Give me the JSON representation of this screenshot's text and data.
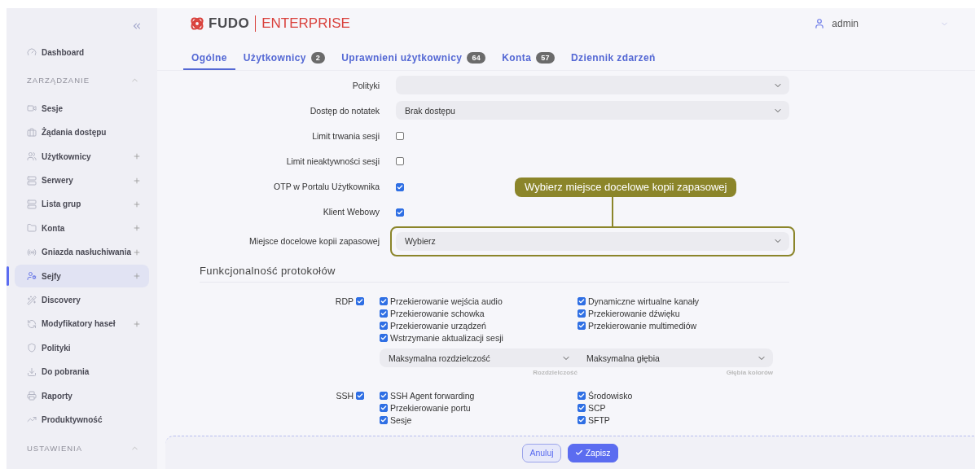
{
  "sidebar": {
    "top_item": {
      "label": "Dashboard",
      "selected": false
    },
    "sections": [
      {
        "title": "ZARZĄDZANIE",
        "expanded": true,
        "items": [
          {
            "label": "Sesje",
            "add": false,
            "selected": false
          },
          {
            "label": "Żądania dostępu",
            "add": false,
            "selected": false
          },
          {
            "label": "Użytkownicy",
            "add": true,
            "selected": false
          },
          {
            "label": "Serwery",
            "add": true,
            "selected": false
          },
          {
            "label": "Lista grup",
            "add": true,
            "selected": false
          },
          {
            "label": "Konta",
            "add": true,
            "selected": false
          },
          {
            "label": "Gniazda nasłuchiwania",
            "add": true,
            "selected": false
          },
          {
            "label": "Sejfy",
            "add": true,
            "selected": true
          },
          {
            "label": "Discovery",
            "add": false,
            "selected": false
          },
          {
            "label": "Modyfikatory haseł",
            "add": true,
            "selected": false
          },
          {
            "label": "Polityki",
            "add": false,
            "selected": false
          },
          {
            "label": "Do pobrania",
            "add": false,
            "selected": false
          },
          {
            "label": "Raporty",
            "add": false,
            "selected": false
          },
          {
            "label": "Produktywność",
            "add": false,
            "selected": false
          }
        ]
      },
      {
        "title": "USTAWIENIA",
        "expanded": true
      }
    ]
  },
  "header": {
    "logo_name": "FUDO",
    "logo_edition": "ENTERPRISE",
    "user": "admin"
  },
  "tabs": [
    {
      "label": "Ogólne",
      "selected": true
    },
    {
      "label": "Użytkownicy",
      "count": "2",
      "selected": false
    },
    {
      "label": "Uprawnieni użytkownicy",
      "count": "64",
      "selected": false
    },
    {
      "label": "Konta",
      "count": "57",
      "selected": false
    },
    {
      "label": "Dziennik zdarzeń",
      "selected": false
    }
  ],
  "form": [
    {
      "kind": "select",
      "label": "Polityki"
    },
    {
      "kind": "select",
      "label": "Dostęp do notatek",
      "value": "Brak dostępu"
    },
    {
      "kind": "checkbox",
      "label": "Limit trwania sesji",
      "checked": false
    },
    {
      "kind": "checkbox",
      "label": "Limit nieaktywności sesji",
      "checked": false
    },
    {
      "kind": "checkbox",
      "label": "OTP w Portalu Użytkownika",
      "checked": true
    },
    {
      "kind": "checkbox",
      "label": "Klient Webowy",
      "checked": true
    },
    {
      "kind": "select",
      "label": "Miejsce docelowe kopii zapasowej",
      "value": "Wybierz",
      "callout": "Wybierz miejsce docelowe kopii zapasowej"
    }
  ],
  "protocols": {
    "title": "Funkcjonalność protokołów",
    "items": [
      {
        "name": "RDP",
        "checked": true,
        "left": [
          {
            "label": "Przekierowanie wejścia audio",
            "checked": true
          },
          {
            "label": "Przekierowanie schowka",
            "checked": true
          },
          {
            "label": "Przekierowanie urządzeń",
            "checked": true
          },
          {
            "label": "Wstrzymanie aktualizacji sesji",
            "checked": true
          }
        ],
        "right": [
          {
            "label": "Dynamiczne wirtualne kanały",
            "checked": true
          },
          {
            "label": "Przekierowanie dźwięku",
            "checked": true
          },
          {
            "label": "Przekierowanie multimediów",
            "checked": true
          }
        ],
        "selects": [
          {
            "value": "Maksymalna rozdzielczość",
            "hint": "Rozdzielczość"
          },
          {
            "value": "Maksymalna głębia",
            "hint": "Głębia kolorów"
          }
        ]
      },
      {
        "name": "SSH",
        "checked": true,
        "left": [
          {
            "label": "SSH Agent forwarding",
            "checked": true
          },
          {
            "label": "Przekierowanie portu",
            "checked": true
          },
          {
            "label": "Sesje",
            "checked": true
          }
        ],
        "right": [
          {
            "label": "Środowisko",
            "checked": true
          },
          {
            "label": "SCP",
            "checked": true
          },
          {
            "label": "SFTP",
            "checked": true
          }
        ]
      }
    ]
  },
  "footer": {
    "buttons": [
      {
        "label": "Anuluj",
        "kind": "secondary"
      },
      {
        "label": "Zapisz",
        "kind": "primary"
      }
    ]
  }
}
